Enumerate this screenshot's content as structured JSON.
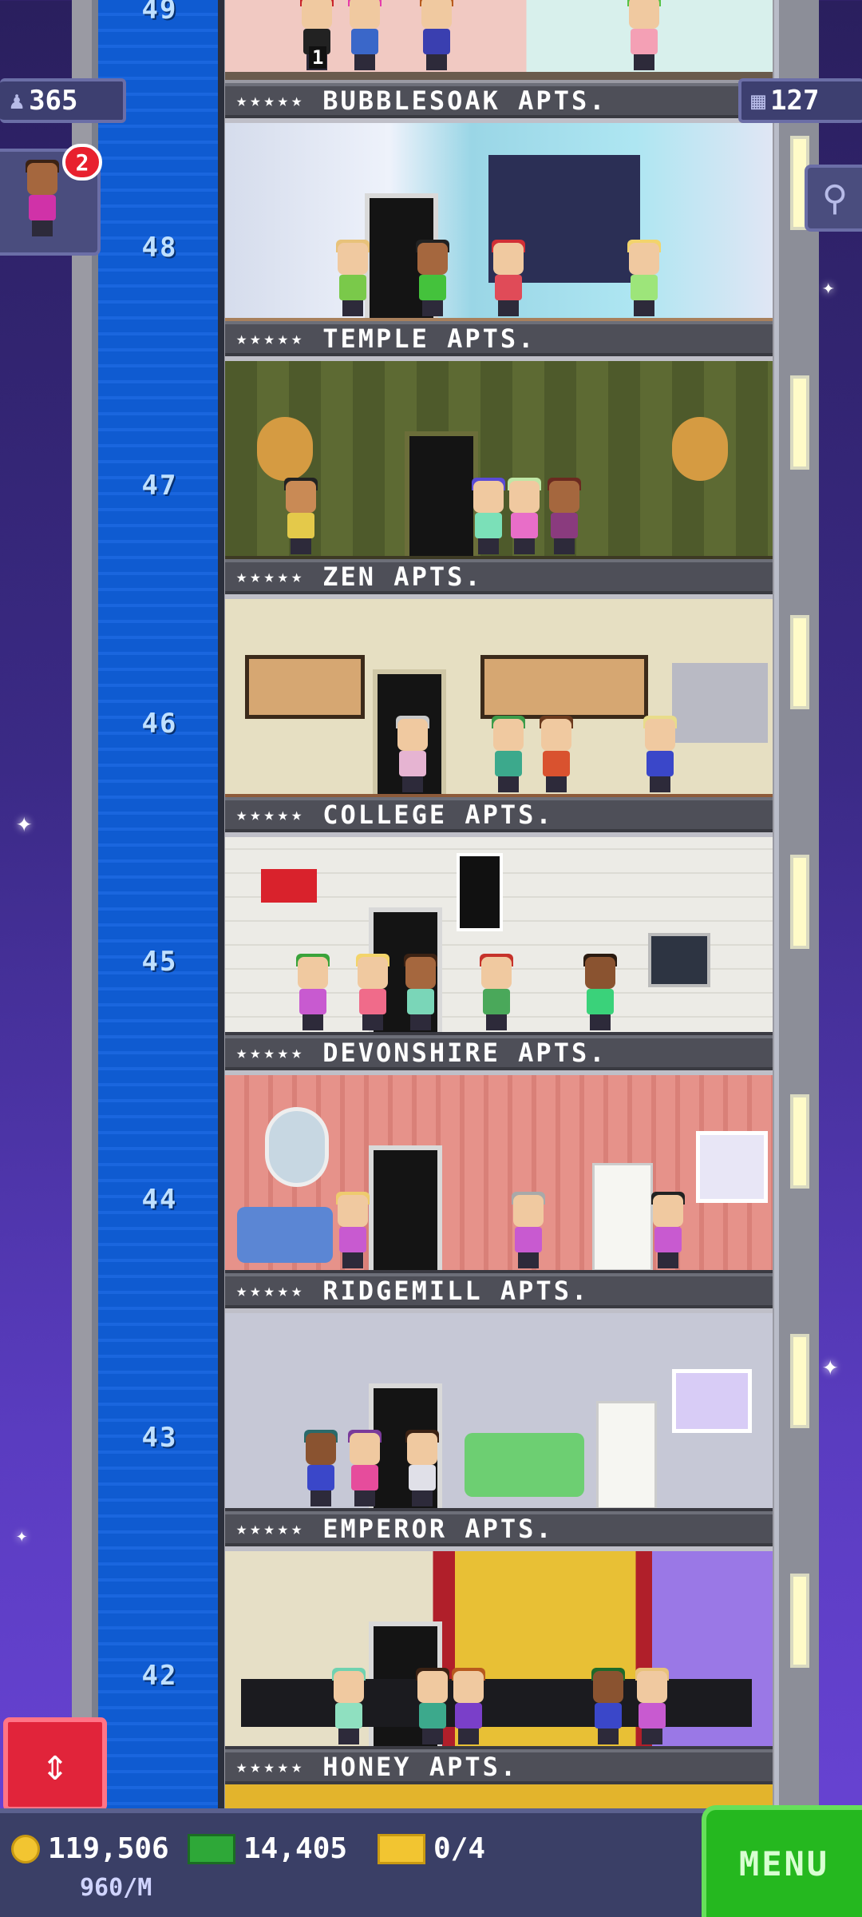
{
  "hud": {
    "population": "365",
    "floors": "127",
    "notification_count": "2"
  },
  "floors": [
    {
      "number": "49",
      "name": "BUBBLESOAK APTS.",
      "stars": "★★★★★"
    },
    {
      "number": "48",
      "name": "TEMPLE APTS.",
      "stars": "★★★★★"
    },
    {
      "number": "47",
      "name": "ZEN APTS.",
      "stars": "★★★★★"
    },
    {
      "number": "46",
      "name": "COLLEGE APTS.",
      "stars": "★★★★★"
    },
    {
      "number": "45",
      "name": "DEVONSHIRE APTS.",
      "stars": "★★★★★"
    },
    {
      "number": "44",
      "name": "RIDGEMILL APTS.",
      "stars": "★★★★★"
    },
    {
      "number": "43",
      "name": "EMPEROR APTS.",
      "stars": "★★★★★"
    },
    {
      "number": "42",
      "name": "HONEY APTS.",
      "stars": "★★★★★"
    }
  ],
  "room_label_49": "1",
  "bottom": {
    "coins": "119,506",
    "coins_rate": "960/M",
    "bux": "14,405",
    "tickets": "0/4",
    "menu_label": "MENU"
  },
  "colors": {
    "shaft": "#1a66de",
    "menu": "#25b81f",
    "elevator_button": "#e1243a"
  }
}
